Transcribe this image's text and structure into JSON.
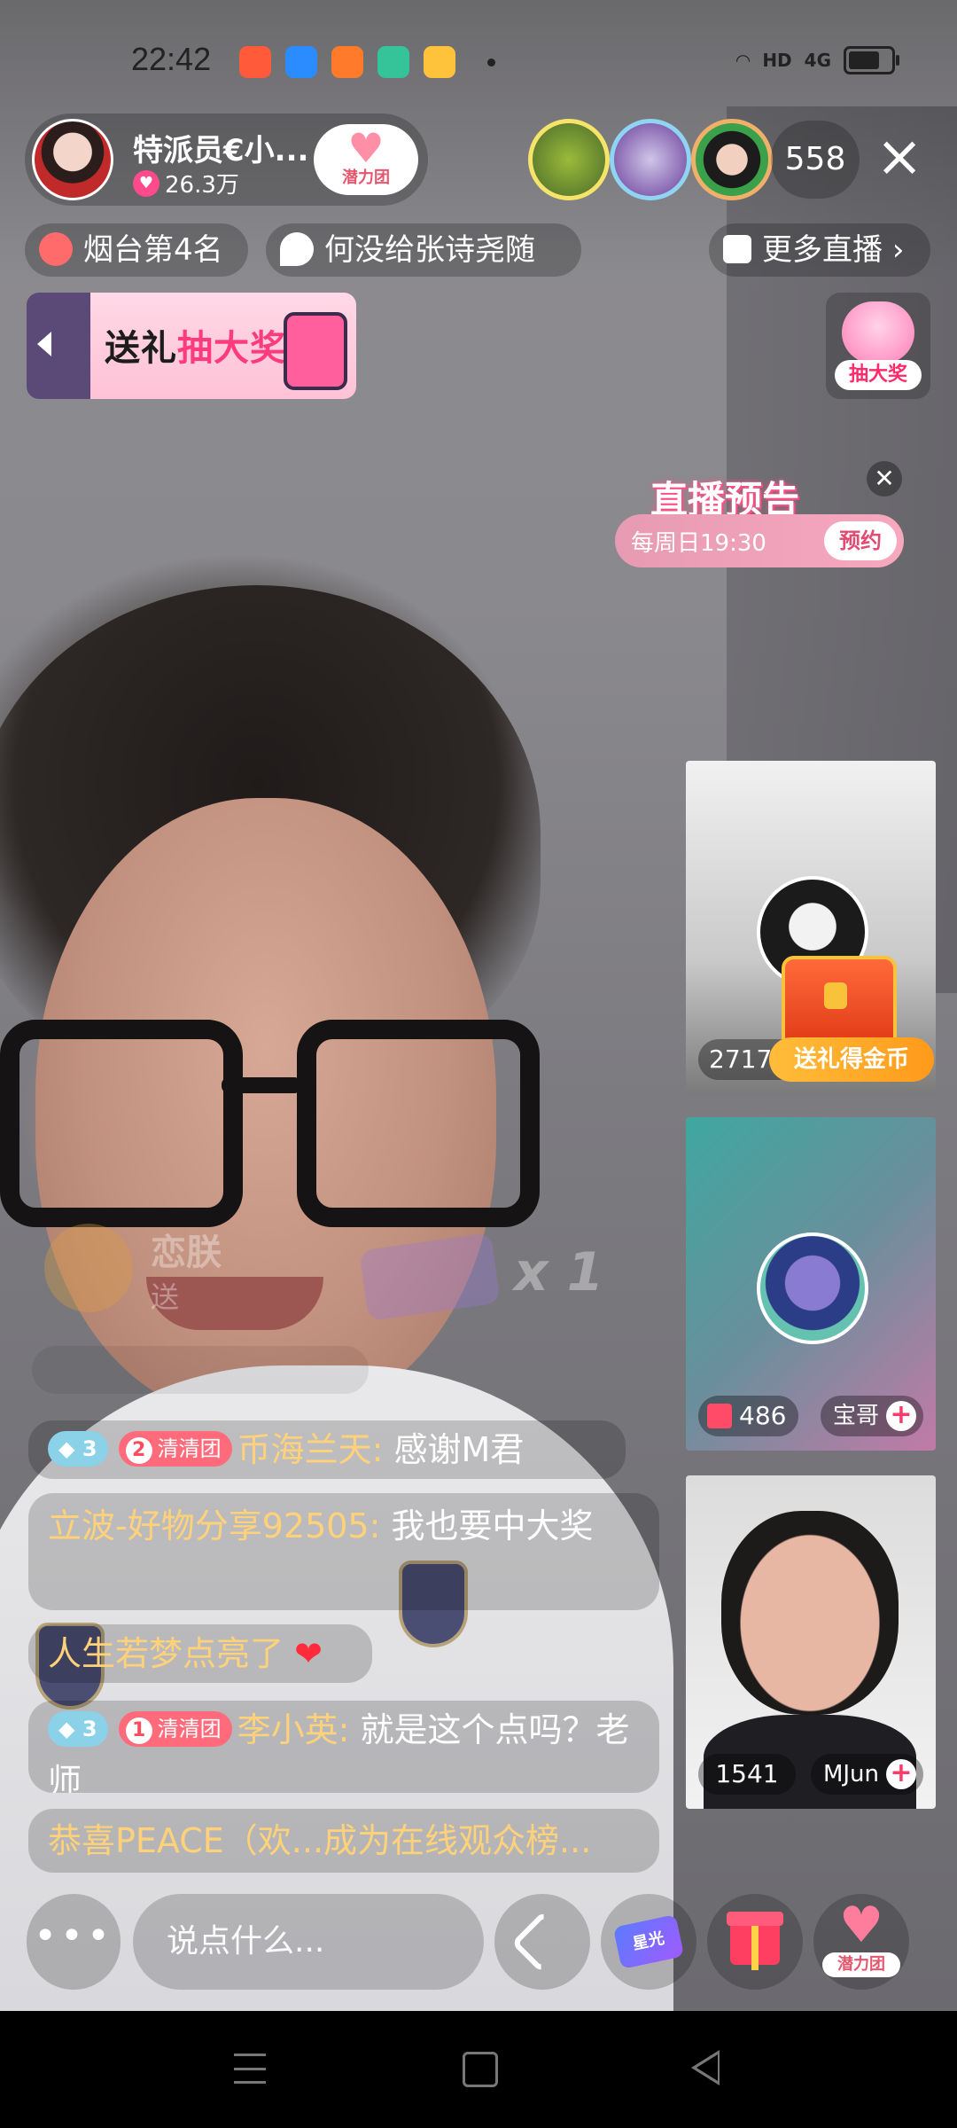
{
  "status_bar": {
    "time": "22:42",
    "app_icons": [
      {
        "name": "kuaishou-icon",
        "color": "#ff5a3a"
      },
      {
        "name": "blue-circle-app-icon",
        "color": "#2a8cff"
      },
      {
        "name": "kuaishou-lite-icon",
        "color": "#ff7a2a"
      },
      {
        "name": "green-circle-app-icon",
        "color": "#35c39a"
      },
      {
        "name": "book-app-icon",
        "color": "#ffc23a"
      }
    ],
    "network": "4G",
    "hd_label": "HD"
  },
  "host": {
    "name": "特派员€小...",
    "likes": "26.3万",
    "fan_group_label": "潜力团"
  },
  "viewers": {
    "count": "558",
    "avatar_colors": [
      "#e8d35a",
      "#7a5fb0",
      "#c0433a"
    ]
  },
  "chips": {
    "rank": "烟台第4名",
    "scroll_text": "何没给张诗尧随",
    "more_live": "更多直播",
    "more_live_chevron": "›"
  },
  "gift_banner": {
    "prefix": "送礼",
    "highlight": "抽大奖"
  },
  "lottery": {
    "label": "抽大奖"
  },
  "preview": {
    "title": "直播预告",
    "schedule": "每周日19:30",
    "reserve_label": "预约",
    "close": "✕"
  },
  "side_cards": [
    {
      "count": "2717",
      "badge": "送礼得金币"
    },
    {
      "count": "486",
      "name": "宝哥"
    },
    {
      "count": "1541",
      "name": "MJun"
    }
  ],
  "gift_animation": {
    "sender": "恋朕",
    "action": "送",
    "multiplier": "x 1"
  },
  "chat": [
    {
      "level": "3",
      "fan_level": "2",
      "fan_group": "清清团",
      "nick": "币海兰天:",
      "text": "感谢M君"
    },
    {
      "nick": "立波-好物分享92505:",
      "text": "我也要中大奖"
    },
    {
      "nick": "人生若梦点亮了",
      "heart": "❤"
    },
    {
      "level": "3",
      "fan_level": "1",
      "fan_group": "清清团",
      "nick": "李小英:",
      "text": "就是这个点吗？老师"
    },
    {
      "nick": "恭喜PEACE（欢...成为在线观众榜..."
    }
  ],
  "toolbar": {
    "more": "•••",
    "input_placeholder": "说点什么...",
    "star_label": "星光",
    "fans_label": "潜力团"
  }
}
